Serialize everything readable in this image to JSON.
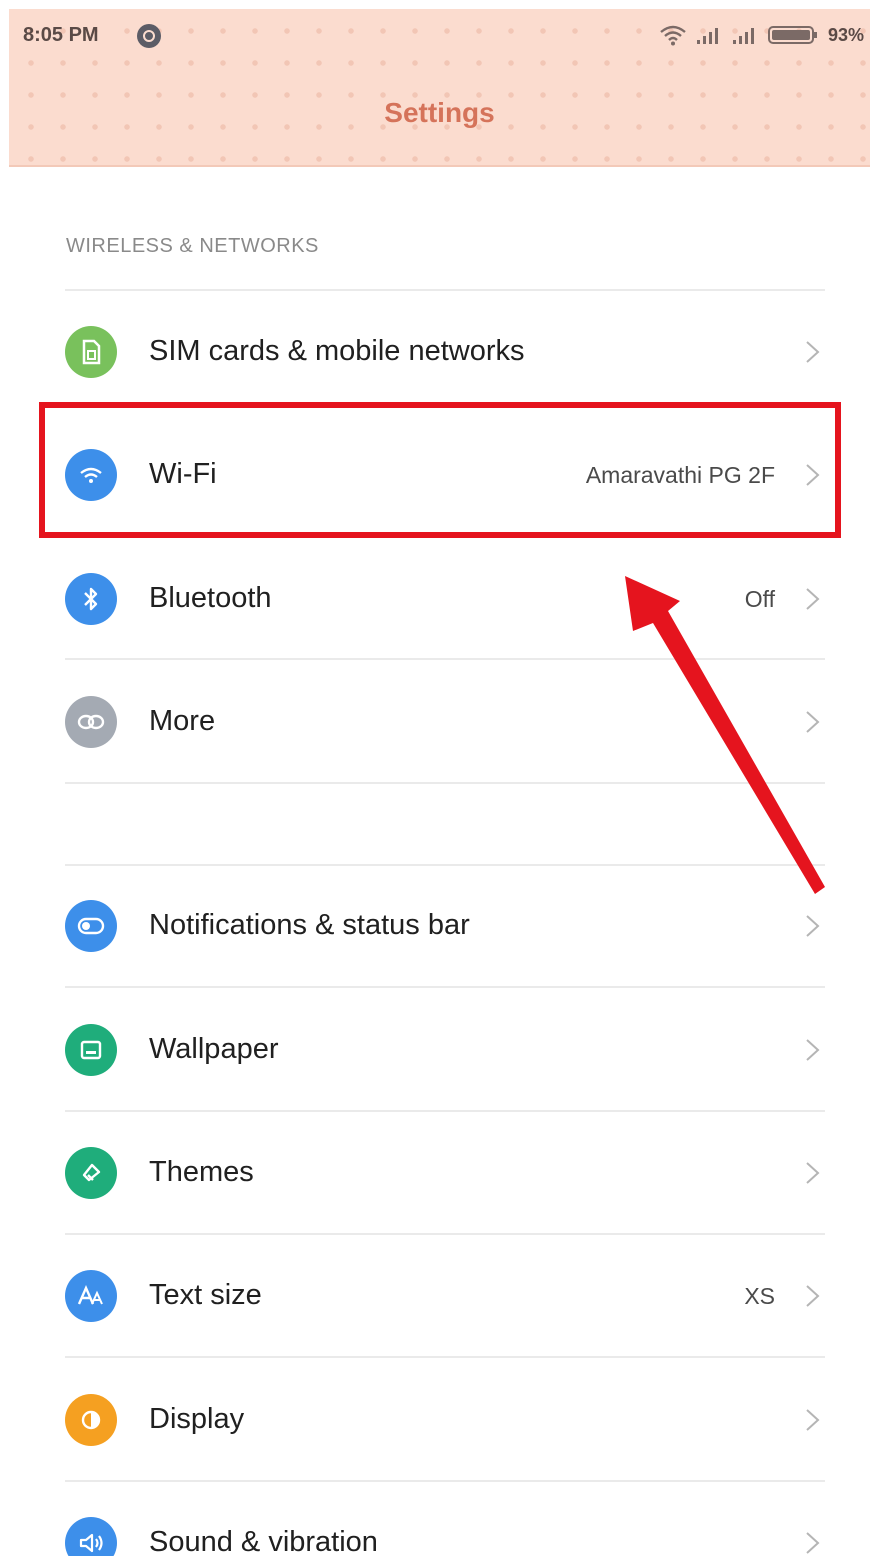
{
  "status_bar": {
    "time": "8:05 PM",
    "battery": "93%",
    "icons": [
      "notification-icon",
      "wifi-icon",
      "signal-icon",
      "signal-icon",
      "battery-icon"
    ]
  },
  "header": {
    "title": "Settings"
  },
  "sections": [
    {
      "title": "WIRELESS & NETWORKS",
      "items": [
        {
          "label": "SIM cards & mobile networks",
          "value": "",
          "icon": "sim-icon",
          "color": "#79c15c"
        },
        {
          "label": "Wi-Fi",
          "value": "Amaravathi PG 2F",
          "icon": "wifi-icon",
          "color": "#3d8fea"
        },
        {
          "label": "Bluetooth",
          "value": "Off",
          "icon": "bluetooth-icon",
          "color": "#3d8fea"
        },
        {
          "label": "More",
          "value": "",
          "icon": "link-icon",
          "color": "#a4aab3"
        }
      ]
    },
    {
      "title": "",
      "items": [
        {
          "label": "Notifications & status bar",
          "value": "",
          "icon": "toggle-icon",
          "color": "#3d8fea"
        },
        {
          "label": "Wallpaper",
          "value": "",
          "icon": "wallpaper-icon",
          "color": "#1fad7b"
        },
        {
          "label": "Themes",
          "value": "",
          "icon": "brush-icon",
          "color": "#1fad7b"
        },
        {
          "label": "Text size",
          "value": "XS",
          "icon": "text-size-icon",
          "color": "#3d8fea"
        },
        {
          "label": "Display",
          "value": "",
          "icon": "contrast-icon",
          "color": "#f5a021"
        },
        {
          "label": "Sound & vibration",
          "value": "",
          "icon": "speaker-icon",
          "color": "#3d8fea"
        }
      ]
    }
  ],
  "annotations": {
    "highlight_color": "#e5141e"
  }
}
